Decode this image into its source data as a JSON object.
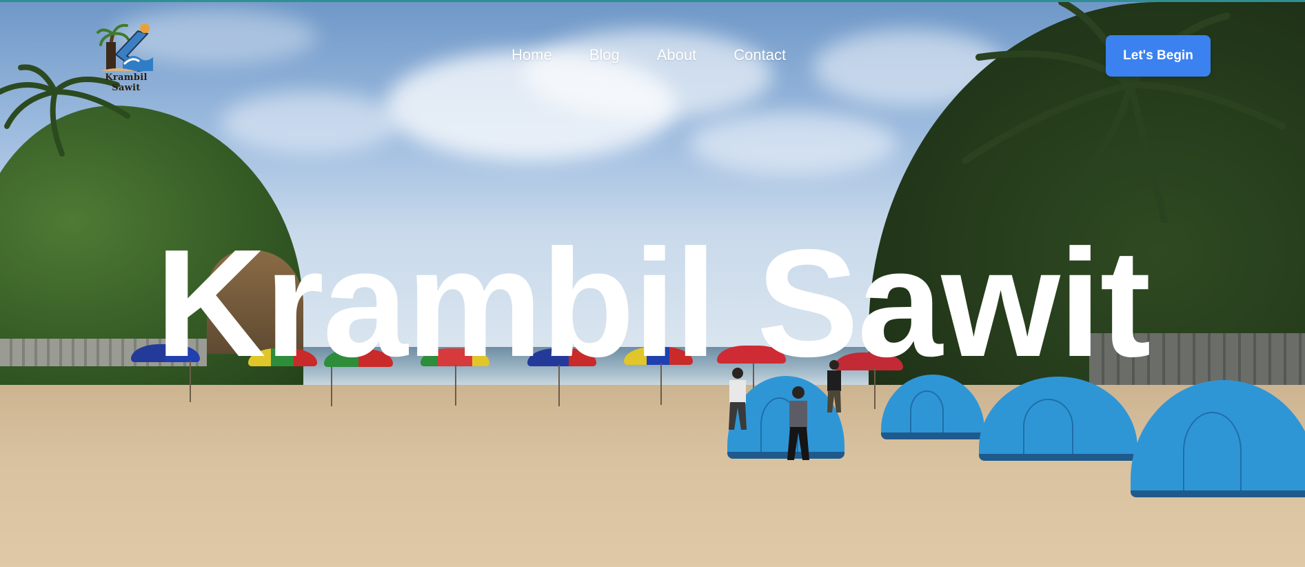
{
  "header": {
    "logo": {
      "text": "Krambil Sawit",
      "icon": "beach-k-logo-icon"
    },
    "nav": [
      {
        "label": "Home"
      },
      {
        "label": "Blog"
      },
      {
        "label": "About"
      },
      {
        "label": "Contact"
      }
    ],
    "cta_label": "Let's Begin"
  },
  "hero": {
    "title": "Krambil Sawit",
    "background": "beach-campsite-photo"
  },
  "colors": {
    "accent": "#3b82f0",
    "top_border": "#2f8f93",
    "title_text": "#ffffff"
  }
}
